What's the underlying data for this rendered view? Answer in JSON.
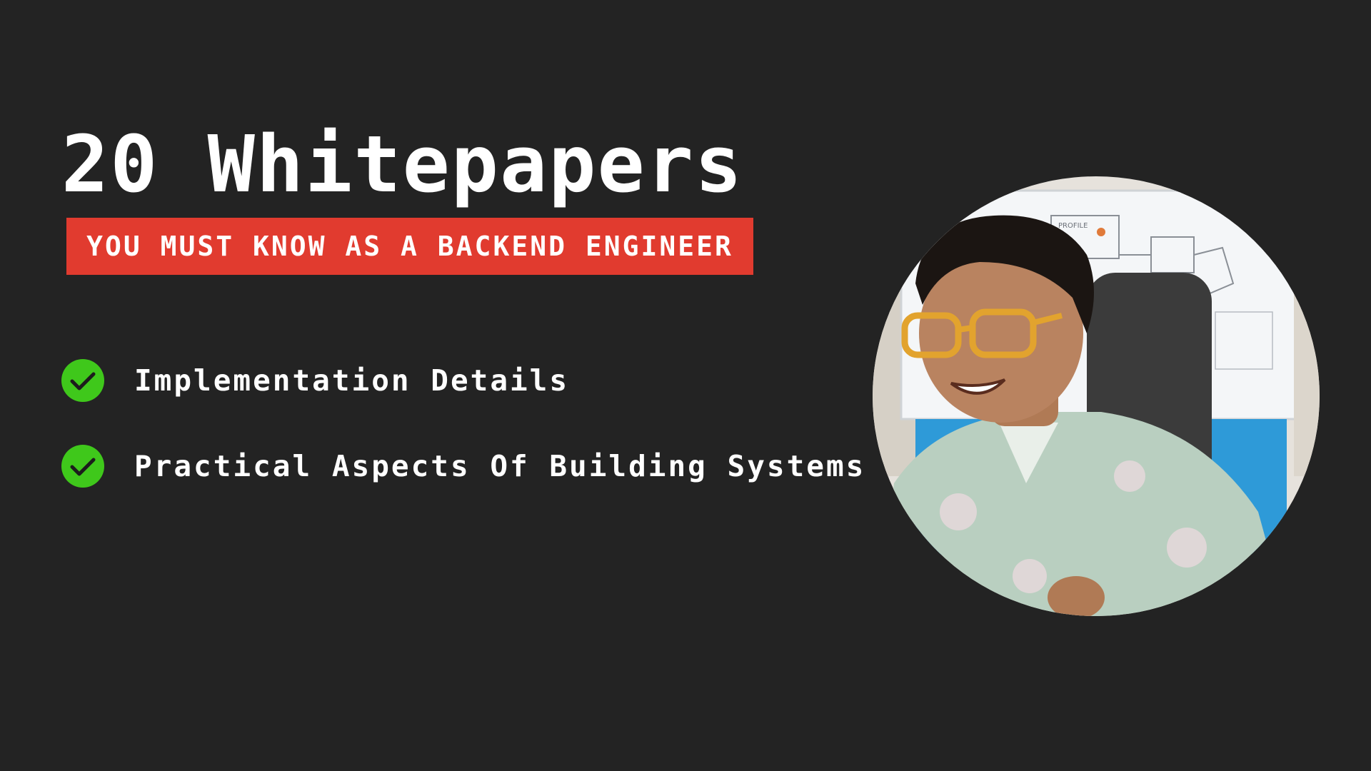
{
  "slide": {
    "title": "20 Whitepapers",
    "subtitle": "YOU MUST KNOW AS A BACKEND ENGINEER",
    "features": [
      {
        "label": "Implementation Details",
        "icon": "check-circle-icon"
      },
      {
        "label": "Practical Aspects Of Building Systems",
        "icon": "check-circle-icon"
      }
    ],
    "whiteboard_note": "PROFILE"
  },
  "colors": {
    "background": "#232323",
    "banner": "#e13b2f",
    "check": "#3fc81b",
    "text": "#ffffff"
  }
}
